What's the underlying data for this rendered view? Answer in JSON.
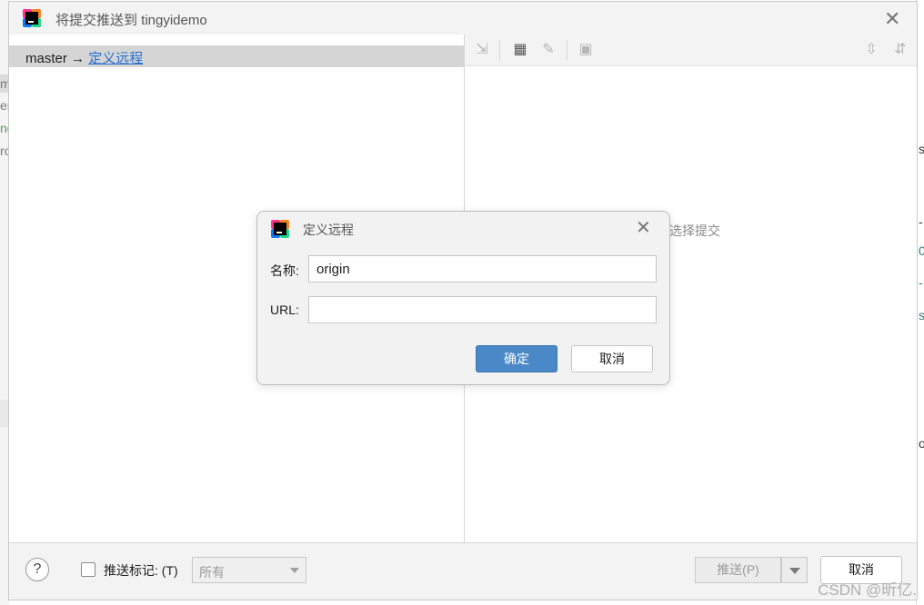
{
  "dialog": {
    "title": "将提交推送到 tingyidemo",
    "branch": {
      "source": "master",
      "arrow": "→",
      "link": "定义远程"
    },
    "empty_hint": "选择提交",
    "bottom": {
      "help": "?",
      "push_tags_label": "推送标记: (T)",
      "tags_select_value": "所有",
      "push_button": "推送(P)",
      "cancel_button": "取消"
    }
  },
  "modal": {
    "title": "定义远程",
    "name_label": "名称:",
    "name_value": "origin",
    "url_label": "URL:",
    "url_value": "",
    "ok_button": "确定",
    "cancel_button": "取消"
  },
  "background": {
    "left_fragments": [
      "m",
      "er",
      "ng",
      "ro"
    ],
    "right_fragments": [
      "s",
      "-",
      "0",
      "-",
      "s",
      "o"
    ]
  },
  "watermark": "CSDN @昕亿.",
  "icons": {
    "app": "intellij-idea-icon",
    "close": "close-icon",
    "toolbar": [
      "cherry-pick-icon",
      "group-icon",
      "edit-icon",
      "preview-icon",
      "expand-all-icon",
      "collapse-all-icon"
    ]
  },
  "colors": {
    "accent": "#4a88c7",
    "link": "#2a6fd0",
    "selection": "#d5d5d5"
  }
}
